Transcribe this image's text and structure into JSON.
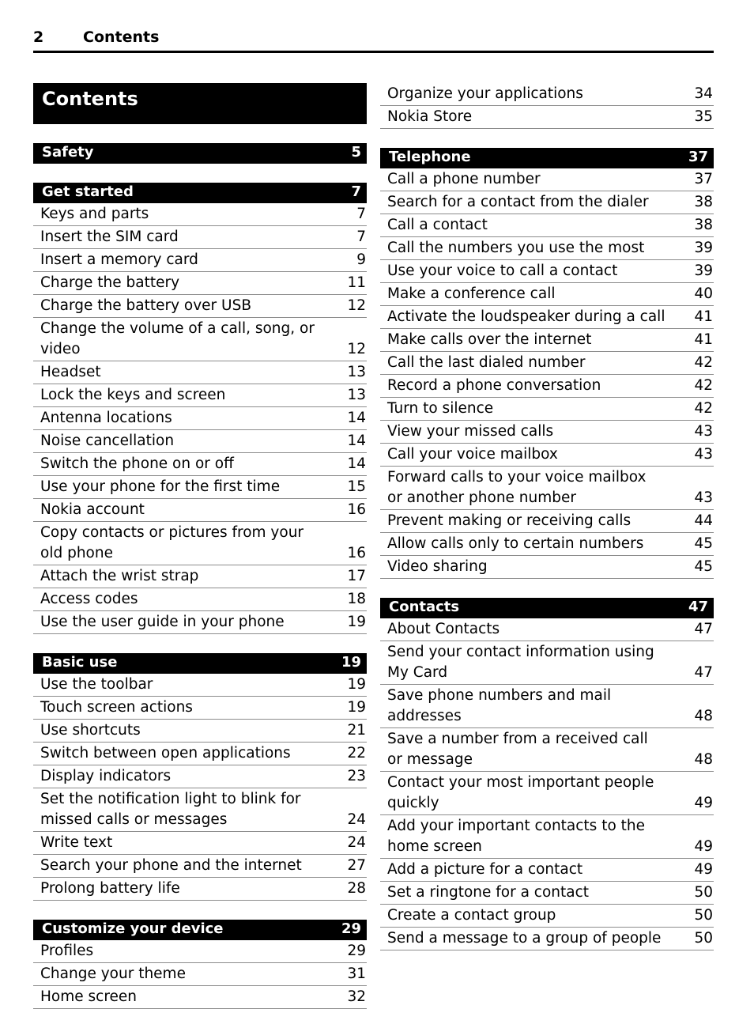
{
  "header": {
    "folio": "2",
    "title": "Contents"
  },
  "contents_title": "Contents",
  "left_column": {
    "sections": [
      {
        "bar": {
          "label": "Safety",
          "page": "5"
        },
        "entries": []
      },
      {
        "bar": {
          "label": "Get started",
          "page": "7"
        },
        "entries": [
          {
            "label": "Keys and parts",
            "page": "7"
          },
          {
            "label": "Insert the SIM card",
            "page": "7"
          },
          {
            "label": "Insert a memory card",
            "page": "9"
          },
          {
            "label": "Charge the battery",
            "page": "11"
          },
          {
            "label": "Charge the battery over USB",
            "page": "12"
          },
          {
            "label": "Change the volume of a call, song, or video",
            "page": "12",
            "wrap": true
          },
          {
            "label": "Headset",
            "page": "13"
          },
          {
            "label": "Lock the keys and screen",
            "page": "13"
          },
          {
            "label": "Antenna locations",
            "page": "14"
          },
          {
            "label": "Noise cancellation",
            "page": "14"
          },
          {
            "label": "Switch the phone on or off",
            "page": "14"
          },
          {
            "label": "Use your phone for the first time",
            "page": "15"
          },
          {
            "label": "Nokia account",
            "page": "16"
          },
          {
            "label": "Copy contacts or pictures from your old phone",
            "page": "16",
            "wrap": true
          },
          {
            "label": "Attach the wrist strap",
            "page": "17"
          },
          {
            "label": "Access codes",
            "page": "18"
          },
          {
            "label": "Use the user guide in your phone",
            "page": "19"
          }
        ]
      },
      {
        "bar": {
          "label": "Basic use",
          "page": "19"
        },
        "entries": [
          {
            "label": "Use the toolbar",
            "page": "19"
          },
          {
            "label": "Touch screen actions",
            "page": "19"
          },
          {
            "label": "Use shortcuts",
            "page": "21"
          },
          {
            "label": "Switch between open applications",
            "page": "22"
          },
          {
            "label": "Display indicators",
            "page": "23"
          },
          {
            "label": "Set the notification light to blink for missed calls or messages",
            "page": "24",
            "wrap": true
          },
          {
            "label": "Write text",
            "page": "24"
          },
          {
            "label": "Search your phone and the internet",
            "page": "27"
          },
          {
            "label": "Prolong battery life",
            "page": "28"
          }
        ]
      },
      {
        "bar": {
          "label": "Customize your device",
          "page": "29"
        },
        "entries": [
          {
            "label": "Profiles",
            "page": "29"
          },
          {
            "label": "Change your theme",
            "page": "31"
          },
          {
            "label": "Home screen",
            "page": "32"
          }
        ]
      }
    ]
  },
  "right_column": {
    "continued_entries": [
      {
        "label": "Organize your applications",
        "page": "34"
      },
      {
        "label": "Nokia Store",
        "page": "35"
      }
    ],
    "sections": [
      {
        "bar": {
          "label": "Telephone",
          "page": "37"
        },
        "entries": [
          {
            "label": "Call a phone number",
            "page": "37"
          },
          {
            "label": "Search for a contact from the dialer",
            "page": "38"
          },
          {
            "label": "Call a contact",
            "page": "38"
          },
          {
            "label": "Call the numbers you use the most",
            "page": "39"
          },
          {
            "label": "Use your voice to call a contact",
            "page": "39"
          },
          {
            "label": "Make a conference call",
            "page": "40"
          },
          {
            "label": "Activate the loudspeaker during a call",
            "page": "41",
            "wrap": true
          },
          {
            "label": "Make calls over the internet",
            "page": "41"
          },
          {
            "label": "Call the last dialed number",
            "page": "42"
          },
          {
            "label": "Record a phone conversation",
            "page": "42"
          },
          {
            "label": "Turn to silence",
            "page": "42"
          },
          {
            "label": "View your missed calls",
            "page": "43"
          },
          {
            "label": "Call your voice mailbox",
            "page": "43"
          },
          {
            "label": "Forward calls to your voice mailbox or another phone number",
            "page": "43",
            "wrap": true
          },
          {
            "label": "Prevent making or receiving calls",
            "page": "44"
          },
          {
            "label": "Allow calls only to certain numbers",
            "page": "45"
          },
          {
            "label": "Video sharing",
            "page": "45"
          }
        ]
      },
      {
        "bar": {
          "label": "Contacts",
          "page": "47"
        },
        "entries": [
          {
            "label": "About Contacts",
            "page": "47"
          },
          {
            "label": "Send your contact information using My Card",
            "page": "47",
            "wrap": true
          },
          {
            "label": "Save phone numbers and mail addresses",
            "page": "48",
            "wrap": true
          },
          {
            "label": "Save a number from a received call or message",
            "page": "48",
            "wrap": true
          },
          {
            "label": "Contact your most important people quickly",
            "page": "49",
            "wrap": true
          },
          {
            "label": "Add your important contacts to the home screen",
            "page": "49",
            "wrap": true
          },
          {
            "label": "Add a picture for a contact",
            "page": "49"
          },
          {
            "label": "Set a ringtone for a contact",
            "page": "50"
          },
          {
            "label": "Create a contact group",
            "page": "50"
          },
          {
            "label": "Send a message to a group of people",
            "page": "50",
            "wrap": true
          }
        ]
      }
    ]
  }
}
